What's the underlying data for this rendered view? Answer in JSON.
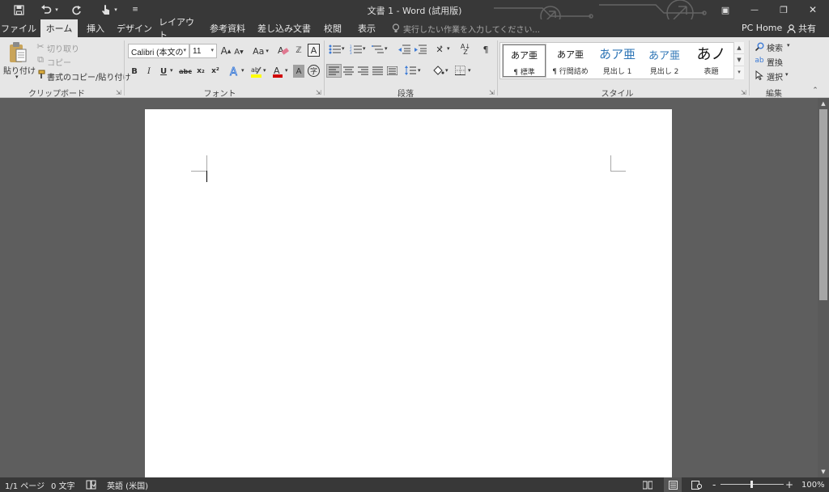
{
  "window": {
    "title": "文書 1 - Word (試用版)",
    "icons": {
      "save": "save-icon",
      "undo": "undo-icon",
      "redo": "redo-icon",
      "touch": "touch-mode-icon"
    },
    "controls": {
      "ribbon_display": "▣",
      "minimize": "—",
      "restore": "❐",
      "close": "✕"
    }
  },
  "tabs": [
    "ファイル",
    "ホーム",
    "挿入",
    "デザイン",
    "レイアウト",
    "参考資料",
    "差し込み文書",
    "校閲",
    "表示"
  ],
  "active_tab": "ホーム",
  "tell_me": "実行したい作業を入力してください...",
  "account": {
    "name": "PC Home",
    "share": "共有"
  },
  "clipboard": {
    "paste": "貼り付け",
    "cut": "切り取り",
    "copy": "コピー",
    "format_painter": "書式のコピー/貼り付け",
    "label": "クリップボード"
  },
  "font": {
    "family": "Calibri (本文の",
    "size": "11",
    "change_case": "Aa",
    "bold": "B",
    "italic": "I",
    "underline": "U",
    "strike": "abc",
    "subscript": "x₂",
    "superscript": "x²",
    "label": "フォント",
    "colors": {
      "highlight": "#ffff00",
      "font_color": "#d00000",
      "text_effects": "#3d7bd6"
    }
  },
  "paragraph": {
    "label": "段落"
  },
  "styles": {
    "label": "スタイル",
    "items": [
      {
        "preview": "あア亜",
        "name": "¶ 標準"
      },
      {
        "preview": "あア亜",
        "name": "¶ 行間詰め"
      },
      {
        "preview": "あア亜",
        "name": "見出し 1"
      },
      {
        "preview": "あア亜",
        "name": "見出し 2"
      },
      {
        "preview": "あノ",
        "name": "表題"
      }
    ],
    "heading_color": "#2e75b6"
  },
  "editing": {
    "find": "検索",
    "replace": "置換",
    "select": "選択",
    "label": "編集"
  },
  "status": {
    "page": "1/1 ページ",
    "words": "0 文字",
    "language": "英語 (米国)",
    "zoom": "100%",
    "zoom_minus": "-",
    "zoom_plus": "+"
  }
}
